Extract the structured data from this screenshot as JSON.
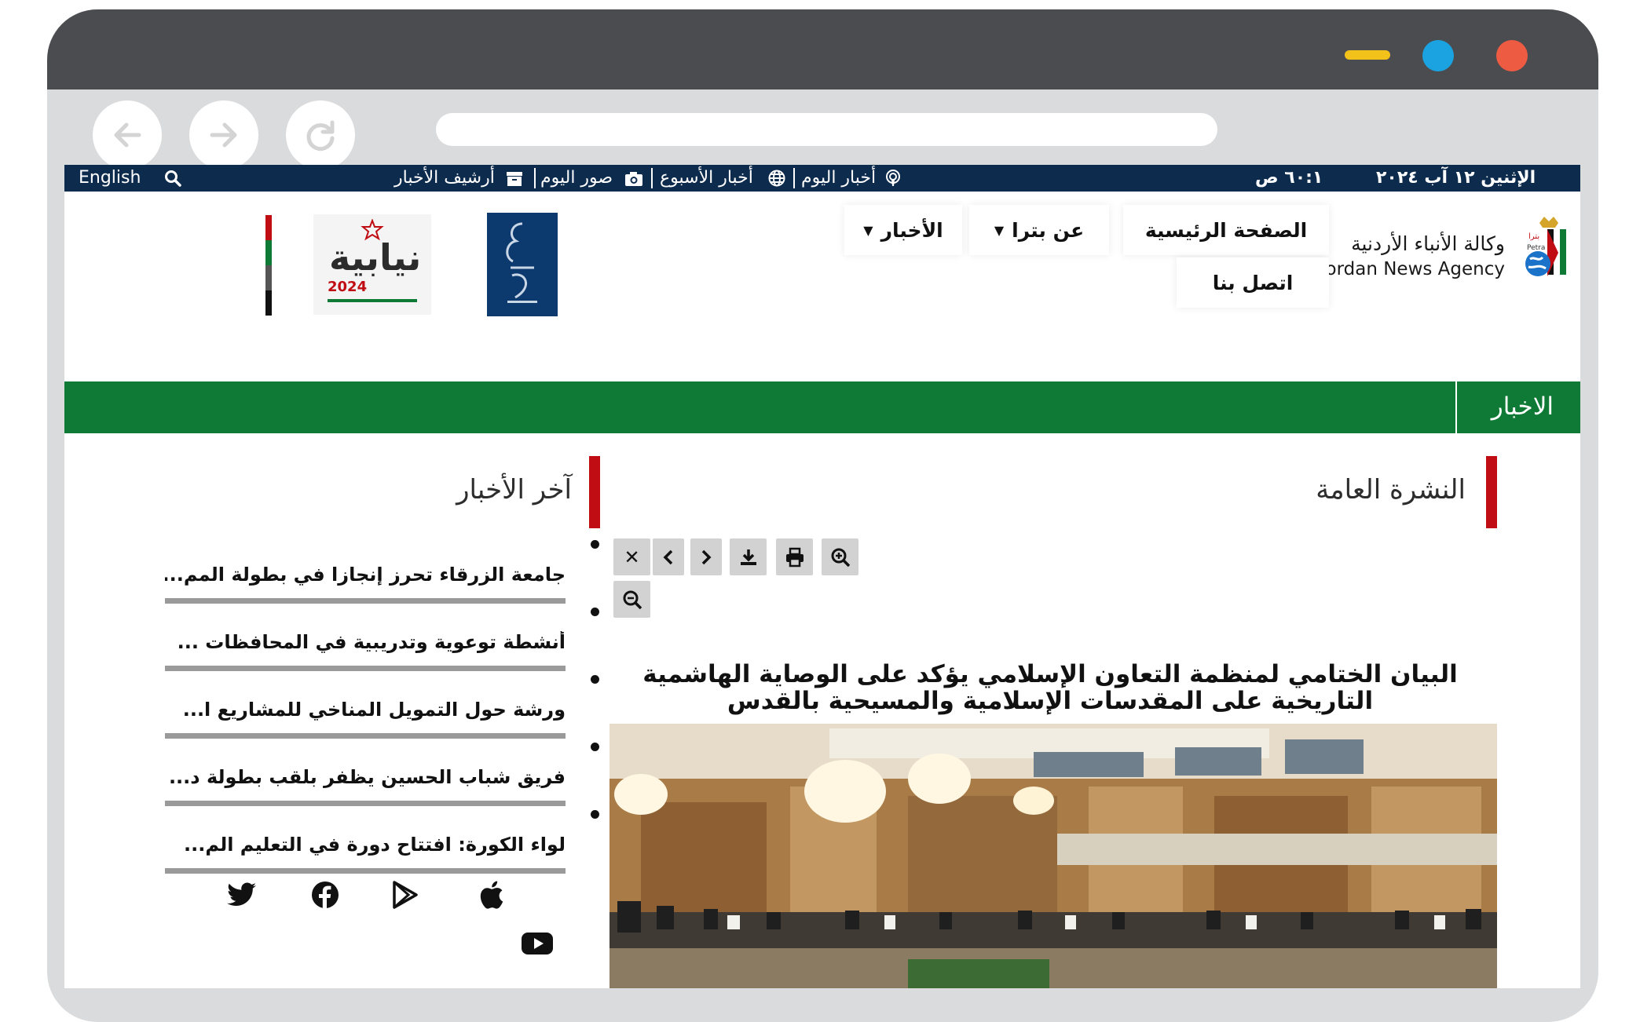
{
  "topbar": {
    "date": "الإثنين ١٢ آب ٢٠٢٤",
    "time": "٦٠:١ ص",
    "links": [
      {
        "label": "أخبار اليوم",
        "icon": "podcast-icon"
      },
      {
        "label": "أخبار الأسبوع",
        "icon": "globe-icon"
      },
      {
        "label": "صور اليوم",
        "icon": "camera-icon"
      },
      {
        "label": "أرشيف الأخبار",
        "icon": "archive-icon"
      }
    ],
    "language": "English",
    "search_icon": "search-icon"
  },
  "header": {
    "logo_text_ar": "وكالة الأنباء الأردنية",
    "logo_text_en": "Jordan News Agency",
    "menu": [
      {
        "label": "الصفحة الرئيسية",
        "has_dropdown": false
      },
      {
        "label": "عن بترا",
        "has_dropdown": true
      },
      {
        "label": "الأخبار",
        "has_dropdown": true
      },
      {
        "label": "اتصل بنا",
        "has_dropdown": false
      }
    ],
    "elections_logo_text": "نيابية",
    "elections_logo_year": "2024"
  },
  "section_bar": {
    "title": "الاخبار"
  },
  "main": {
    "section_title": "النشرة العامة",
    "toolbar": [
      "close-icon",
      "chevron-left-icon",
      "chevron-right-icon",
      "download-icon",
      "print-icon",
      "zoom-in-icon",
      "zoom-out-icon"
    ],
    "headline": "البيان الختامي لمنظمة التعاون الإسلامي يؤكد على الوصاية الهاشمية التاريخية على المقدسات الإسلامية والمسيحية بالقدس"
  },
  "sidebar": {
    "title": "آخر الأخبار",
    "items": [
      "جامعة الزرقاء تحرز إنجازا في بطولة المم...",
      "أنشطة توعوية وتدريبية في المحافظات ...",
      "ورشة حول التمويل المناخي للمشاريع ا...",
      "فريق شباب الحسين يظفر بلقب بطولة د...",
      "لواء الكورة: افتتاح دورة في التعليم الم..."
    ],
    "social": [
      "twitter-icon",
      "facebook-icon",
      "google-play-icon",
      "apple-icon",
      "youtube-icon"
    ]
  },
  "colors": {
    "topbar": "#0d2b4d",
    "green": "#0f7a35",
    "red_accent": "#c00d13",
    "frame": "#4b4c4f"
  }
}
